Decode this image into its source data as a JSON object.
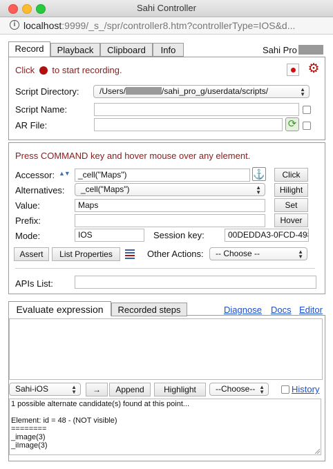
{
  "window": {
    "title": "Sahi Controller"
  },
  "url": {
    "host": "localhost",
    "rest": ":9999/_s_/spr/controller8.htm?controllerType=IOS&d..."
  },
  "tabs": [
    "Record",
    "Playback",
    "Clipboard",
    "Info"
  ],
  "brand": "Sahi Pro",
  "record": {
    "click_text": "Click",
    "start_text": "to start recording.",
    "script_dir_label": "Script Directory:",
    "script_dir_prefix": "/Users/",
    "script_dir_suffix": "/sahi_pro_g/userdata/scripts/",
    "script_name_label": "Script Name:",
    "script_name_value": "",
    "ar_file_label": "AR File:",
    "ar_file_value": ""
  },
  "inspector": {
    "hint": "Press COMMAND key and hover mouse over any element.",
    "accessor_label": "Accessor:",
    "accessor_value": "_cell(\"Maps\")",
    "alternatives_label": "Alternatives:",
    "alternatives_value": "_cell(\"Maps\")",
    "value_label": "Value:",
    "value_value": "Maps",
    "prefix_label": "Prefix:",
    "prefix_value": "",
    "mode_label": "Mode:",
    "mode_value": "IOS",
    "session_label": "Session key:",
    "session_value": "00DEDDA3-0FCD-498",
    "click_btn": "Click",
    "hilight_btn": "Hilight",
    "set_btn": "Set",
    "hover_btn": "Hover",
    "assert_btn": "Assert",
    "list_props_btn": "List Properties",
    "other_actions_label": "Other Actions:",
    "other_actions_value": "-- Choose --",
    "apis_label": "APIs List:",
    "apis_value": ""
  },
  "bottom": {
    "tabs": [
      "Evaluate expression",
      "Recorded steps"
    ],
    "links": [
      "Diagnose",
      "Docs",
      "Editor"
    ],
    "expression": "",
    "lang_select": "Sahi-iOS",
    "arrow_btn": "→",
    "append_btn": "Append",
    "highlight_btn": "Highlight",
    "choose_select": "--Choose--",
    "history_link": "History",
    "log_lines": [
      "1 possible alternate candidate(s) found at this point...",
      "",
      "Element: id = 48 - (NOT visible)",
      "========",
      "_image(3)",
      "_iImage(3)"
    ]
  },
  "colors": {
    "record_dot": "#b01010",
    "accent_maroon": "#8b1a1a",
    "link": "#1a4fcf"
  }
}
